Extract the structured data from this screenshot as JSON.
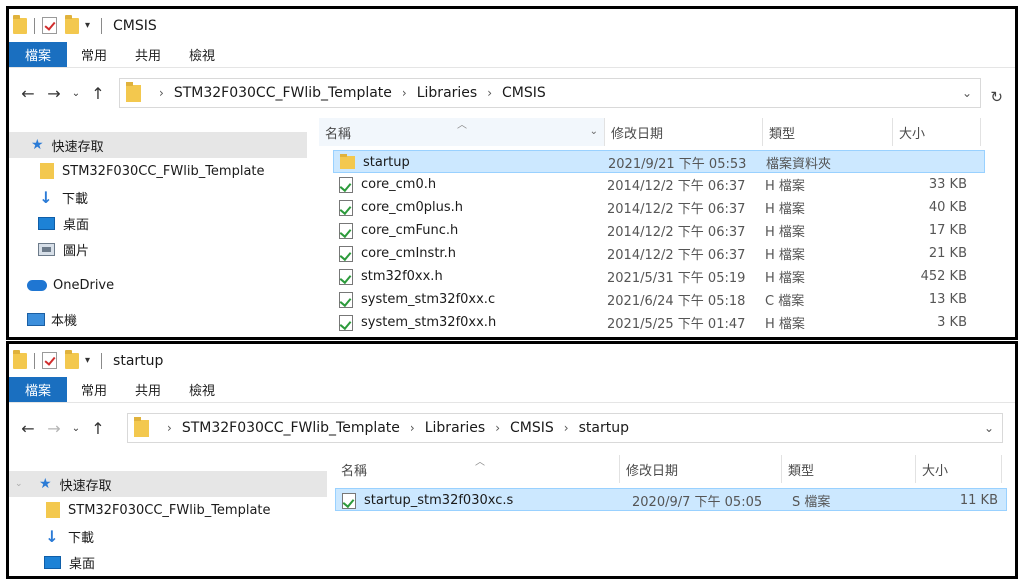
{
  "window1": {
    "title": "CMSIS",
    "ribbon": [
      "檔案",
      "常用",
      "共用",
      "檢視"
    ],
    "breadcrumbs": [
      "STM32F030CC_FWlib_Template",
      "Libraries",
      "CMSIS"
    ],
    "nav_pane": [
      {
        "label": "快速存取",
        "icon": "star-icon",
        "selected": true
      },
      {
        "label": "STM32F030CC_FWlib_Template",
        "icon": "folder-icon",
        "selected": false
      },
      {
        "label": "下載",
        "icon": "download-icon",
        "selected": false
      },
      {
        "label": "桌面",
        "icon": "desktop-icon",
        "selected": false
      },
      {
        "label": "圖片",
        "icon": "pictures-icon",
        "selected": false
      },
      {
        "label": "OneDrive",
        "icon": "cloud-icon",
        "selected": false
      },
      {
        "label": "本機",
        "icon": "computer-icon",
        "selected": false
      }
    ],
    "columns": {
      "name": "名稱",
      "date": "修改日期",
      "type": "類型",
      "size": "大小"
    },
    "files": [
      {
        "name": "startup",
        "date": "2021/9/21 下午 05:53",
        "type": "檔案資料夾",
        "size": "",
        "icon": "folder-icon",
        "selected": true
      },
      {
        "name": "core_cm0.h",
        "date": "2014/12/2 下午 06:37",
        "type": "H 檔案",
        "size": "33 KB",
        "icon": "file-icon"
      },
      {
        "name": "core_cm0plus.h",
        "date": "2014/12/2 下午 06:37",
        "type": "H 檔案",
        "size": "40 KB",
        "icon": "file-icon"
      },
      {
        "name": "core_cmFunc.h",
        "date": "2014/12/2 下午 06:37",
        "type": "H 檔案",
        "size": "17 KB",
        "icon": "file-icon"
      },
      {
        "name": "core_cmInstr.h",
        "date": "2014/12/2 下午 06:37",
        "type": "H 檔案",
        "size": "21 KB",
        "icon": "file-icon"
      },
      {
        "name": "stm32f0xx.h",
        "date": "2021/5/31 下午 05:19",
        "type": "H 檔案",
        "size": "452 KB",
        "icon": "file-icon"
      },
      {
        "name": "system_stm32f0xx.c",
        "date": "2021/6/24 下午 05:18",
        "type": "C 檔案",
        "size": "13 KB",
        "icon": "file-icon"
      },
      {
        "name": "system_stm32f0xx.h",
        "date": "2021/5/25 下午 01:47",
        "type": "H 檔案",
        "size": "3 KB",
        "icon": "file-icon"
      }
    ]
  },
  "window2": {
    "title": "startup",
    "ribbon": [
      "檔案",
      "常用",
      "共用",
      "檢視"
    ],
    "breadcrumbs": [
      "STM32F030CC_FWlib_Template",
      "Libraries",
      "CMSIS",
      "startup"
    ],
    "nav_pane": [
      {
        "label": "快速存取",
        "icon": "star-icon",
        "selected": true
      },
      {
        "label": "STM32F030CC_FWlib_Template",
        "icon": "folder-icon",
        "selected": false
      },
      {
        "label": "下載",
        "icon": "download-icon",
        "selected": false
      },
      {
        "label": "桌面",
        "icon": "desktop-icon",
        "selected": false
      }
    ],
    "columns": {
      "name": "名稱",
      "date": "修改日期",
      "type": "類型",
      "size": "大小"
    },
    "files": [
      {
        "name": "startup_stm32f030xc.s",
        "date": "2020/9/7 下午 05:05",
        "type": "S 檔案",
        "size": "11 KB",
        "icon": "file-icon",
        "selected": true
      }
    ]
  }
}
